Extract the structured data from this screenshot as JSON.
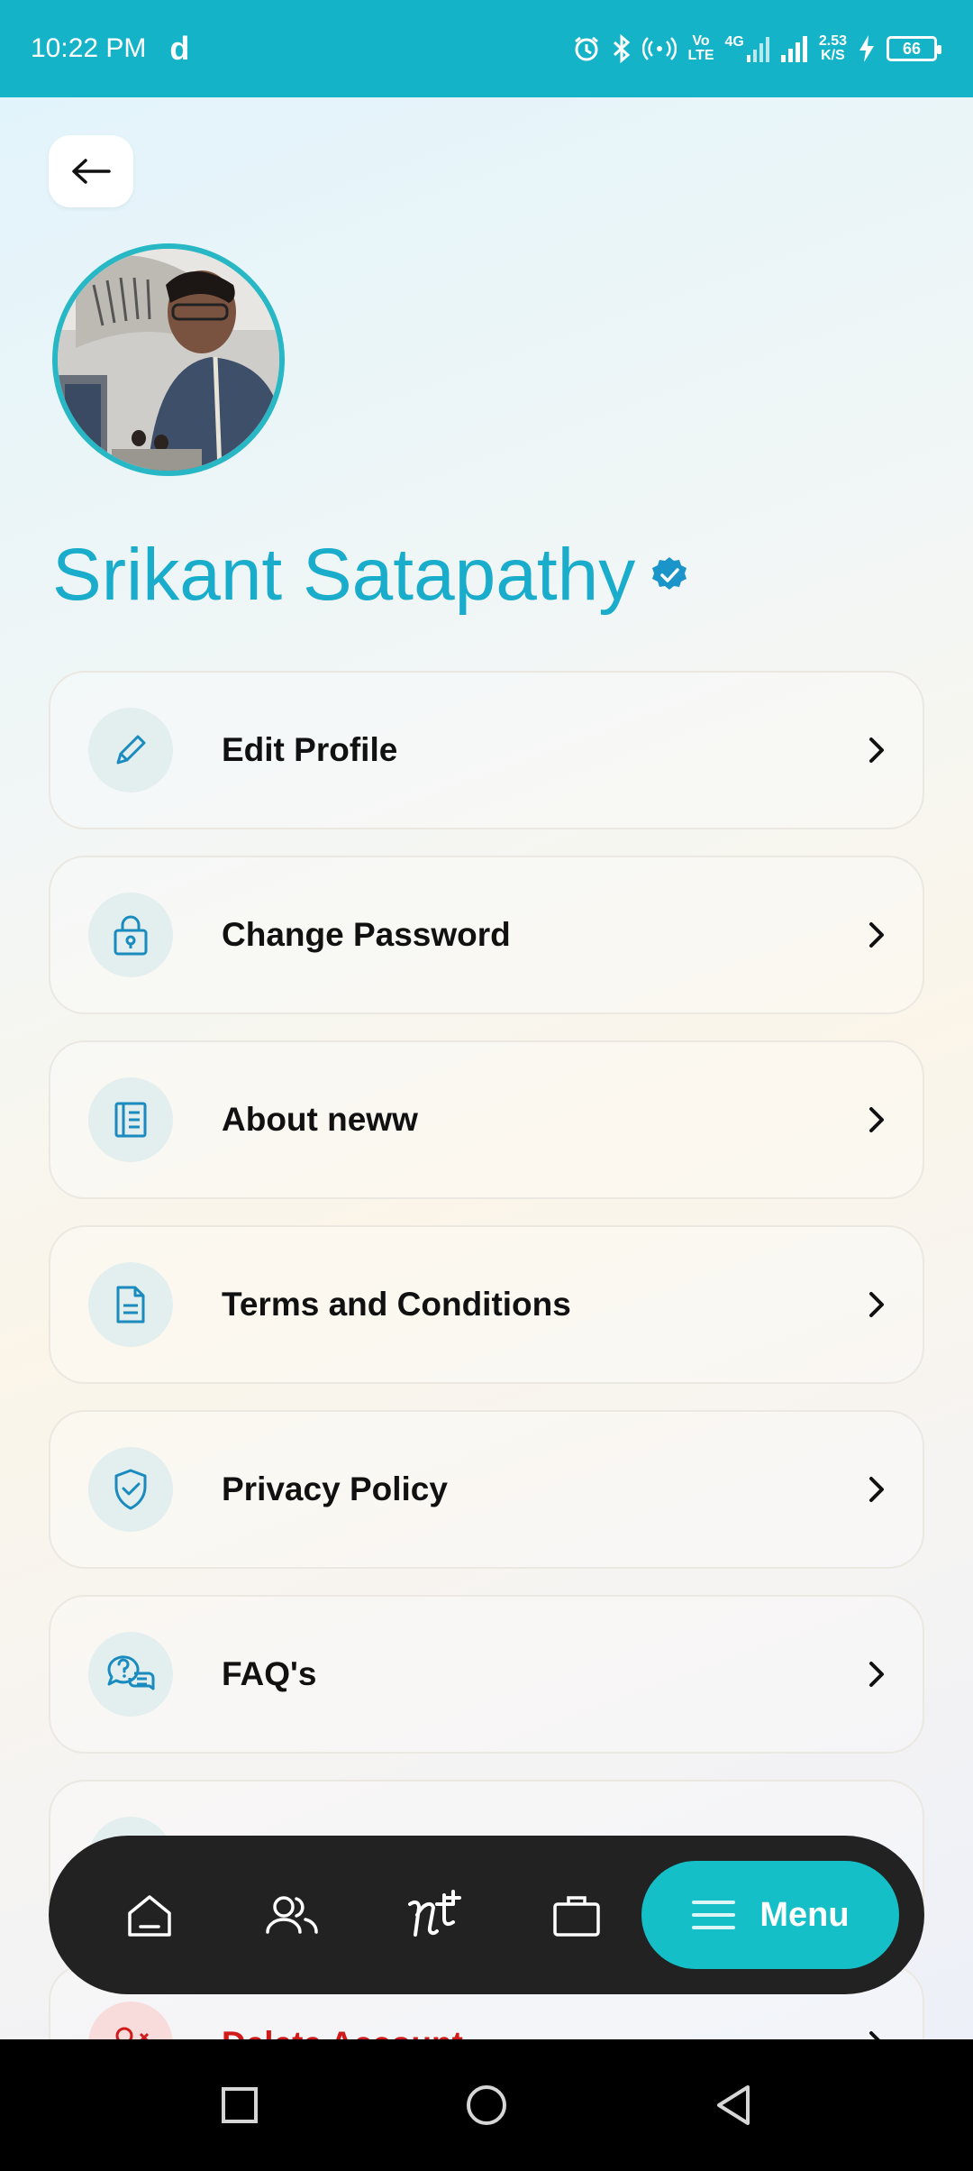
{
  "status_bar": {
    "time": "10:22 PM",
    "app_letter": "d",
    "volte_top": "Vo",
    "volte_bottom": "LTE",
    "network": "4G",
    "speed_top": "2.53",
    "speed_bottom": "K/S",
    "battery": "66"
  },
  "profile": {
    "name": "Srikant Satapathy"
  },
  "menu": {
    "items": [
      {
        "label": "Edit Profile",
        "icon": "pencil-icon"
      },
      {
        "label": "Change Password",
        "icon": "lock-icon"
      },
      {
        "label": "About neww",
        "icon": "notebook-icon"
      },
      {
        "label": "Terms and Conditions",
        "icon": "document-icon"
      },
      {
        "label": "Privacy Policy",
        "icon": "shield-check-icon"
      },
      {
        "label": "FAQ's",
        "icon": "chat-question-icon"
      },
      {
        "label": "",
        "icon": "partial-icon"
      },
      {
        "label": "Delete Account",
        "icon": "user-remove-icon"
      }
    ]
  },
  "bottom_nav": {
    "menu_label": "Menu"
  },
  "colors": {
    "accent": "#14b3c7",
    "name": "#1aaccb",
    "danger": "#d11a1a"
  }
}
